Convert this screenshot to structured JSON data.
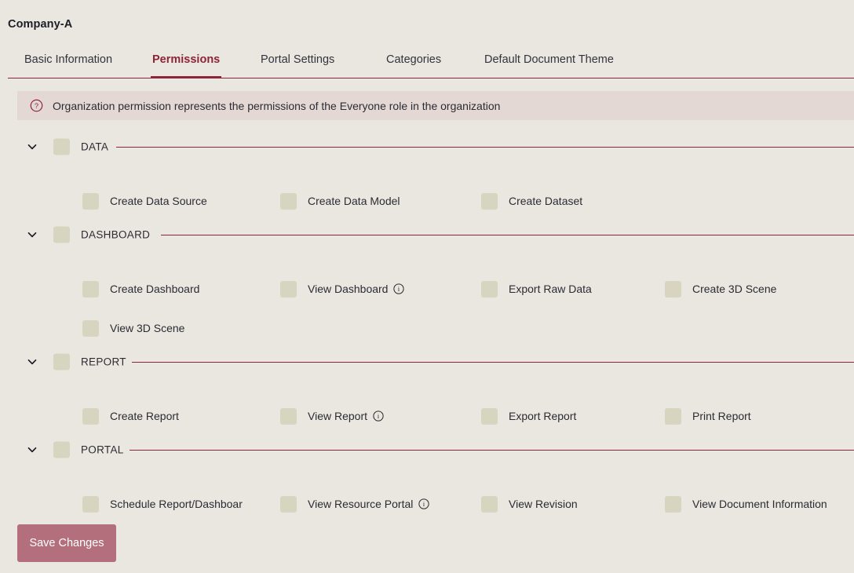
{
  "header": {
    "org_title": "Company-A"
  },
  "tabs": [
    {
      "label": "Basic Information",
      "active": false
    },
    {
      "label": "Permissions",
      "active": true
    },
    {
      "label": "Portal Settings",
      "active": false
    },
    {
      "label": "Categories",
      "active": false
    },
    {
      "label": "Default Document Theme",
      "active": false
    }
  ],
  "notice": {
    "icon": "question-circle-icon",
    "text": "Organization permission represents the permissions of the Everyone role in the organization",
    "background_color": "#e4d8d5"
  },
  "colors": {
    "page_background": "#eae7e0",
    "accent": "#8d2437",
    "checkbox": "#d7d4c0",
    "save_button": "#b3707c",
    "text": "#2b2b33"
  },
  "sections": [
    {
      "name": "DATA",
      "expanded": true,
      "chevron": "chevron-down-icon",
      "checked": false,
      "rows": [
        [
          {
            "label": "Create Data Source",
            "checked": false,
            "info": false
          },
          {
            "label": "Create Data Model",
            "checked": false,
            "info": false
          },
          {
            "label": "Create Dataset",
            "checked": false,
            "info": false
          }
        ]
      ]
    },
    {
      "name": "DASHBOARD",
      "expanded": true,
      "chevron": "chevron-down-icon",
      "checked": false,
      "rows": [
        [
          {
            "label": "Create Dashboard",
            "checked": false,
            "info": false
          },
          {
            "label": "View Dashboard",
            "checked": false,
            "info": true
          },
          {
            "label": "Export Raw Data",
            "checked": false,
            "info": false
          },
          {
            "label": "Create 3D Scene",
            "checked": false,
            "info": false
          }
        ],
        [
          {
            "label": "View 3D Scene",
            "checked": false,
            "info": false
          }
        ]
      ]
    },
    {
      "name": "REPORT",
      "expanded": true,
      "chevron": "chevron-down-icon",
      "checked": false,
      "rows": [
        [
          {
            "label": "Create Report",
            "checked": false,
            "info": false
          },
          {
            "label": "View Report",
            "checked": false,
            "info": true
          },
          {
            "label": "Export Report",
            "checked": false,
            "info": false
          },
          {
            "label": "Print Report",
            "checked": false,
            "info": false
          }
        ]
      ]
    },
    {
      "name": "PORTAL",
      "expanded": true,
      "chevron": "chevron-down-icon",
      "checked": false,
      "rows": [
        [
          {
            "label": "Schedule Report/Dashboar",
            "checked": false,
            "info": false
          },
          {
            "label": "View Resource Portal",
            "checked": false,
            "info": true
          },
          {
            "label": "View Revision",
            "checked": false,
            "info": false
          },
          {
            "label": "View Document Information",
            "checked": false,
            "info": false
          }
        ]
      ]
    }
  ],
  "footer": {
    "save_label": "Save Changes"
  }
}
